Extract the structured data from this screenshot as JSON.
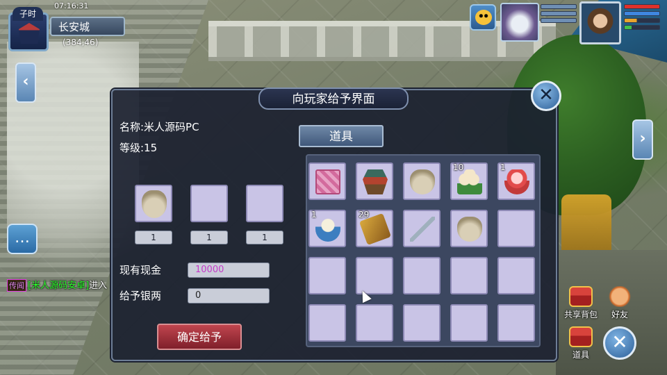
{
  "location": {
    "time_period": "子时",
    "clock": "07:16:31",
    "city": "长安城",
    "coordinates": "(384,46)"
  },
  "status_bars": {
    "summon": [
      {
        "color": "#6f8fb4",
        "fill": 1.0
      },
      {
        "color": "#6f8fb4",
        "fill": 1.0
      },
      {
        "color": "#6f8fb4",
        "fill": 1.0
      }
    ],
    "player": [
      {
        "color": "#e0312a",
        "fill": 1.0
      },
      {
        "color": "#3f87e0",
        "fill": 1.0
      },
      {
        "color": "#e8a52d",
        "fill": 0.35
      },
      {
        "color": "#41c24a",
        "fill": 0.2
      }
    ]
  },
  "chat": {
    "tag": "传闻",
    "message": "[米人源码安卓]",
    "tail": "进入"
  },
  "dialog": {
    "title": "向玩家给予界面",
    "target_name": "名称:米人源码PC",
    "target_level": "等级:15",
    "give_slots": [
      {
        "item": "money-bag",
        "qty": "1"
      },
      {
        "item": "",
        "qty": "1"
      },
      {
        "item": "",
        "qty": "1"
      }
    ],
    "cash_label": "现有现金",
    "cash_value": "10000",
    "give_label": "给予银两",
    "give_value": "0",
    "confirm_label": "确定给予",
    "items_tab": "道具",
    "inventory": [
      {
        "item": "gift-box",
        "count": ""
      },
      {
        "item": "armor",
        "count": ""
      },
      {
        "item": "money-bag",
        "count": ""
      },
      {
        "item": "steamed-buns",
        "count": "10"
      },
      {
        "item": "red-soup-bowl",
        "count": "1"
      },
      {
        "item": "rice-bowl",
        "count": "1"
      },
      {
        "item": "scroll",
        "count": "29"
      },
      {
        "item": "sword",
        "count": ""
      },
      {
        "item": "money-bag",
        "count": ""
      },
      {
        "item": "",
        "count": ""
      }
    ]
  },
  "hud": {
    "shared_bag": "共享背包",
    "friends": "好友",
    "items": "道具"
  }
}
